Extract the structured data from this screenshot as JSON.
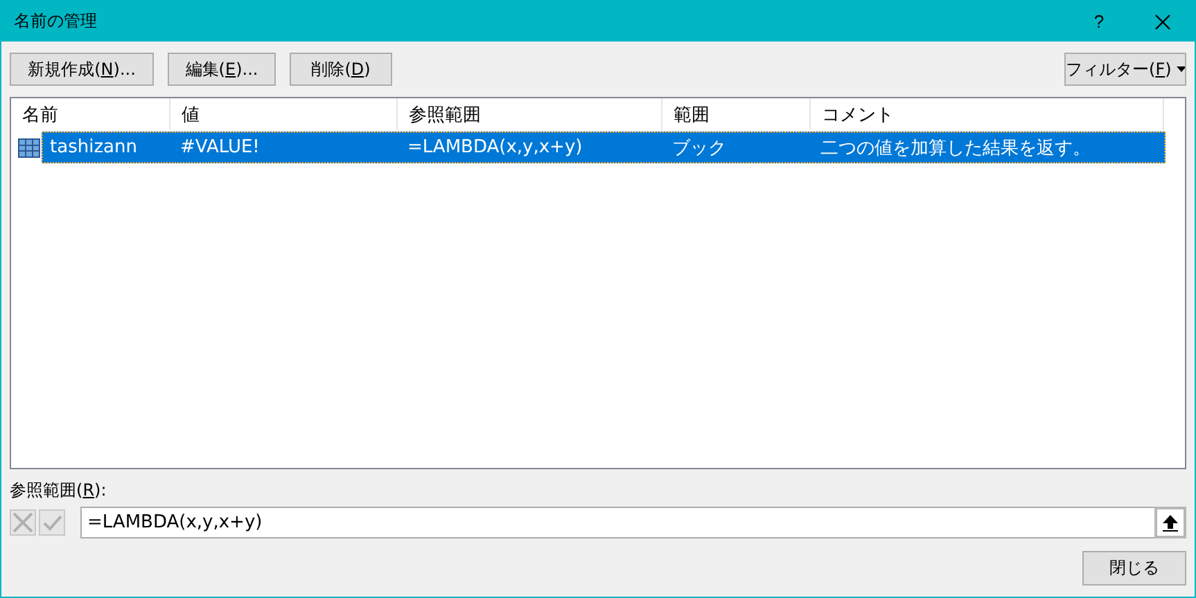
{
  "window": {
    "title": "名前の管理",
    "help": "?"
  },
  "toolbar": [
    {
      "before": "新規作成(",
      "key": "N",
      "after": ")..."
    },
    {
      "before": "編集(",
      "key": "E",
      "after": ")..."
    },
    {
      "before": "削除(",
      "key": "D",
      "after": ")"
    }
  ],
  "filter": {
    "before": "フィルター(",
    "key": "F",
    "after": ")"
  },
  "table": {
    "columns": [
      "名前",
      "値",
      "参照範囲",
      "範囲",
      "コメント"
    ],
    "rows": [
      {
        "selected": true,
        "cells": [
          "tashizann",
          "#VALUE!",
          "=LAMBDA(x,y,x+y)",
          "ブック",
          "二つの値を加算した結果を返す。"
        ]
      }
    ]
  },
  "refers_to": {
    "label": {
      "before": "参照範囲(",
      "key": "R",
      "after": "):"
    },
    "value": "=LAMBDA(x,y,x+y)",
    "cancel_disabled": true,
    "enter_disabled": true
  },
  "close_button": "閉じる"
}
